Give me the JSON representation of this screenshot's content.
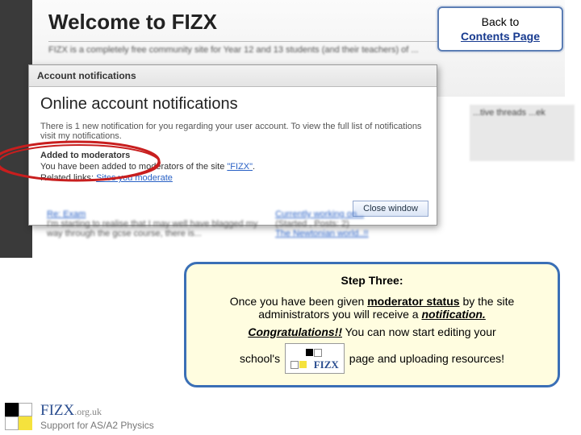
{
  "nav": {
    "back_line1": "Back to",
    "back_line2": "Contents Page"
  },
  "bg": {
    "welcome_title": "Welcome to FIZX",
    "blurb": "FIZX is a completely free community site for Year 12 and 13 students (and their teachers) of ...",
    "side_text": "...tive threads ...ek"
  },
  "modal": {
    "titlebar": "Account notifications",
    "heading": "Online account notifications",
    "descr": "There is 1 new notification for you regarding your user account. To view the full list of notifications visit my notifications.",
    "section_head": "Added to moderators",
    "section_body_prefix": "You have been added to moderators of the site ",
    "site_link": "\"FIZX\"",
    "related_prefix": "Related links: ",
    "related_link": "Sites you moderate",
    "close_label": "Close window"
  },
  "blur": {
    "left_title": "Re: Exam",
    "left_body": "I'm starting to realise that I may well have blagged my way through the gcse course, there is...",
    "right_title": "Currently working on...",
    "right_sub": "(Started , Posts: 2)",
    "right_link": "The Newtonian world..!!"
  },
  "step": {
    "title": "Step Three:",
    "p1_a": "Once you have been given ",
    "p1_u": "moderator status",
    "p1_b": " by the site administrators you will receive a ",
    "p1_u2": "notification.",
    "p2_a": "Congratulations!!",
    "p2_b": "  You can now start editing your",
    "p3_a": "school's",
    "logo_text": "FIZX",
    "p3_b": "page and uploading resources!"
  },
  "footer": {
    "brand": "FIZX",
    "suffix": ".org.uk",
    "sub": "Support for AS/A2 Physics"
  }
}
